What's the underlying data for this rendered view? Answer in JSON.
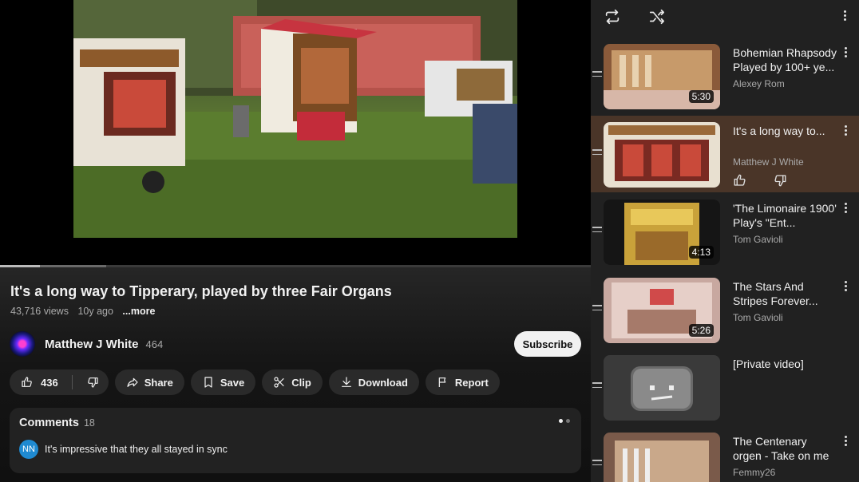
{
  "video": {
    "title": "It's a long way to Tipperary, played by three Fair Organs",
    "views": "43,716 views",
    "age": "10y ago",
    "more": "...more",
    "progress_played": 0.067,
    "progress_buffered": 0.18
  },
  "channel": {
    "name": "Matthew J White",
    "subs": "464",
    "subscribe_label": "Subscribe"
  },
  "actions": {
    "likes": "436",
    "share": "Share",
    "save": "Save",
    "clip": "Clip",
    "download": "Download",
    "report": "Report"
  },
  "comments": {
    "label": "Comments",
    "count": "18",
    "first_avatar": "NN",
    "first_text": "It's impressive that they all stayed in sync"
  },
  "playlist": [
    {
      "title": "Bohemian Rhapsody Played by 100+ ye...",
      "channel": "Alexey Rom",
      "duration": "5:30",
      "active": false
    },
    {
      "title": "It's a long way to...",
      "channel": "Matthew J White",
      "duration": "",
      "active": true
    },
    {
      "title": "'The Limonaire 1900' Play's \"Ent...",
      "channel": "Tom Gavioli",
      "duration": "4:13",
      "active": false
    },
    {
      "title": "The Stars And Stripes Forever...",
      "channel": "Tom Gavioli",
      "duration": "5:26",
      "active": false
    },
    {
      "title": "[Private video]",
      "channel": "",
      "duration": "",
      "active": false
    },
    {
      "title": "The Centenary orgen - Take on me",
      "channel": "Femmy26",
      "duration": "",
      "active": false
    }
  ],
  "colors": {
    "active_item_bg": "#4a3528",
    "comment_avatar": "#1f8ad1"
  }
}
